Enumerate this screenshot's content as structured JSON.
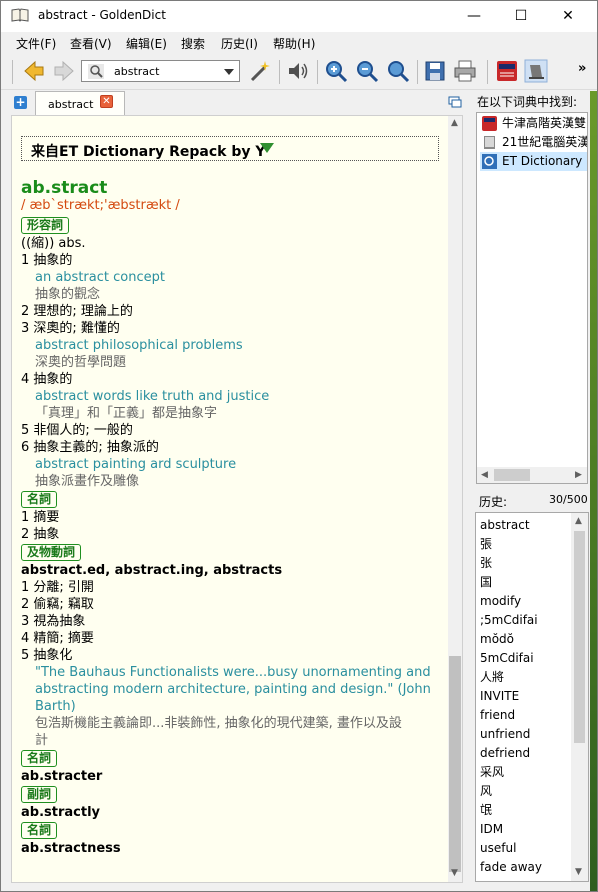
{
  "window": {
    "title": "abstract - GoldenDict"
  },
  "menu": [
    "文件(F)",
    "查看(V)",
    "编辑(E)",
    "搜索",
    "历史(I)",
    "帮助(H)"
  ],
  "toolbar": {
    "search_value": "abstract",
    "more": "»"
  },
  "tab": {
    "label": "abstract"
  },
  "source": {
    "label": "来自ET Dictionary Repack by Y"
  },
  "entry": {
    "headword": "ab.stract",
    "phonetic": "/ æb`strækt;'æbstrækt /",
    "lines": [
      {
        "kind": "pos",
        "text": "形容詞"
      },
      {
        "kind": "def",
        "text": "((縮)) abs."
      },
      {
        "kind": "def",
        "text": "1 抽象的"
      },
      {
        "kind": "ex",
        "text": "an abstract concept"
      },
      {
        "kind": "tr",
        "text": "抽象的觀念"
      },
      {
        "kind": "def",
        "text": "2 理想的; 理論上的"
      },
      {
        "kind": "def",
        "text": "3 深奧的; 難懂的"
      },
      {
        "kind": "ex",
        "text": "abstract philosophical problems"
      },
      {
        "kind": "tr",
        "text": "深奧的哲學問題"
      },
      {
        "kind": "def",
        "text": "4 抽象的"
      },
      {
        "kind": "ex",
        "text": "abstract words like truth and justice"
      },
      {
        "kind": "tr",
        "text": "「真理」和「正義」都是抽象字"
      },
      {
        "kind": "def",
        "text": "5 非個人的; 一般的"
      },
      {
        "kind": "def",
        "text": "6 抽象主義的; 抽象派的"
      },
      {
        "kind": "ex",
        "text": "abstract painting ard sculpture"
      },
      {
        "kind": "tr",
        "text": "抽象派畫作及雕像"
      },
      {
        "kind": "pos",
        "text": "名詞"
      },
      {
        "kind": "def",
        "text": "1 摘要"
      },
      {
        "kind": "def",
        "text": "2 抽象"
      },
      {
        "kind": "pos",
        "text": "及物動詞"
      },
      {
        "kind": "bold",
        "text": "abstract.ed, abstract.ing, abstracts"
      },
      {
        "kind": "def",
        "text": "1 分離; 引開"
      },
      {
        "kind": "def",
        "text": "2 偷竊; 竊取"
      },
      {
        "kind": "def",
        "text": "3 視為抽象"
      },
      {
        "kind": "def",
        "text": "4 精簡; 摘要"
      },
      {
        "kind": "def",
        "text": "5 抽象化"
      },
      {
        "kind": "ex",
        "text": "\"The Bauhaus Functionalists were...busy unornamenting and"
      },
      {
        "kind": "ex",
        "text": "abstracting modern architecture, painting and design.\" (John"
      },
      {
        "kind": "ex",
        "text": "Barth)"
      },
      {
        "kind": "tr",
        "text": "包浩斯機能主義論即...非裝飾性, 抽象化的現代建築, 畫作以及設"
      },
      {
        "kind": "tr",
        "text": "計"
      },
      {
        "kind": "pos",
        "text": "名詞"
      },
      {
        "kind": "bold",
        "text": "ab.stracter"
      },
      {
        "kind": "pos",
        "text": "副詞"
      },
      {
        "kind": "bold",
        "text": "ab.stractly"
      },
      {
        "kind": "pos",
        "text": "名詞"
      },
      {
        "kind": "bold",
        "text": "ab.stractness"
      }
    ]
  },
  "found_in": {
    "label": "在以下词典中找到:",
    "items": [
      "牛津高階英漢雙",
      "21世紀電腦英漢",
      "ET Dictionary R"
    ]
  },
  "history": {
    "label": "历史:",
    "count": "30/500",
    "items": [
      "abstract",
      "張",
      "张",
      "国",
      "modify",
      ";5mCdifai",
      "mŏdŏ",
      "5mCdifai",
      "人將",
      "INVITE",
      "friend",
      "unfriend",
      "defriend",
      "采风",
      "风",
      "氓",
      "IDM",
      "useful",
      "fade away"
    ]
  }
}
